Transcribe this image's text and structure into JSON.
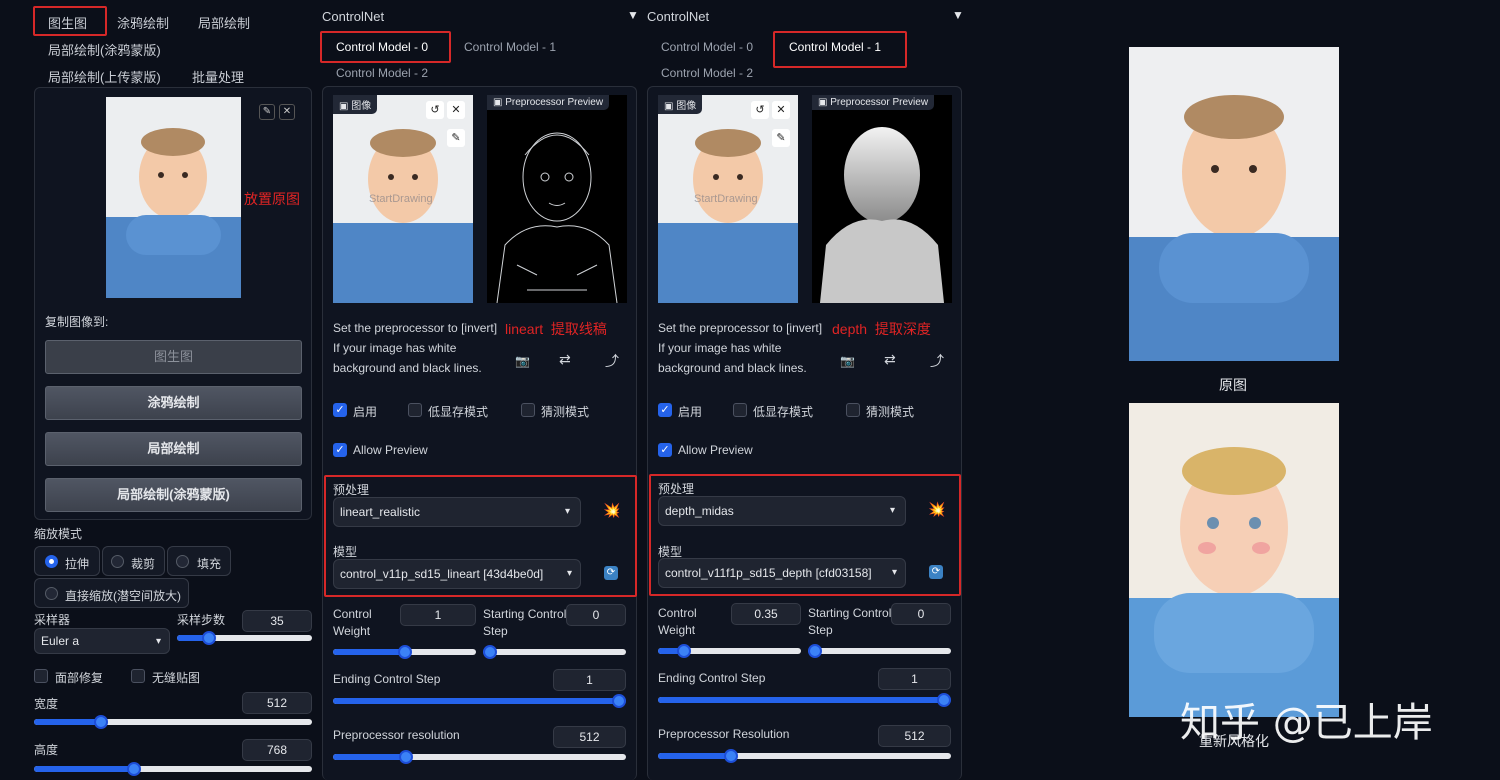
{
  "left": {
    "tabs": [
      "图生图",
      "涂鸦绘制",
      "局部绘制",
      "局部绘制(涂鸦蒙版)",
      "局部绘制(上传蒙版)",
      "批量处理"
    ],
    "annotation_place": "放置原图",
    "copy_label": "复制图像到:",
    "copy_buttons": [
      "图生图",
      "涂鸦绘制",
      "局部绘制",
      "局部绘制(涂鸦蒙版)"
    ],
    "resize_mode_label": "缩放模式",
    "resize_options": [
      "拉伸",
      "裁剪",
      "填充",
      "直接缩放(潜空间放大)"
    ],
    "sampler_label": "采样器",
    "sampler_value": "Euler a",
    "steps_label": "采样步数",
    "steps_value": "35",
    "steps_fraction": 0.24,
    "face_restore": "面部修复",
    "tiling": "无缝贴图",
    "width_label": "宽度",
    "width_value": "512",
    "width_fraction": 0.24,
    "height_label": "高度",
    "height_value": "768",
    "height_fraction": 0.36
  },
  "cn": [
    {
      "title": "ControlNet",
      "tabs": [
        "Control Model - 0",
        "Control Model - 1",
        "Control Model - 2"
      ],
      "active_tab": 0,
      "image_tag": "图像",
      "preview_tag": "Preprocessor Preview",
      "watermark": "StartDrawing",
      "hint": [
        "Set the preprocessor to [invert]",
        "If your image has white",
        "background and black lines."
      ],
      "annotation": "lineart  提取线稿",
      "enable": "启用",
      "lowvram": "低显存模式",
      "guess": "猜测模式",
      "allow_preview": "Allow Preview",
      "pre_label": "预处理",
      "pre_value": "lineart_realistic",
      "model_label": "模型",
      "model_value": "control_v11p_sd15_lineart [43d4be0d]",
      "weight_label": "Control Weight",
      "weight_value": "1",
      "weight_fraction": 0.5,
      "start_label": "Starting Control Step",
      "start_value": "0",
      "start_fraction": 0.0,
      "end_label": "Ending Control Step",
      "end_value": "1",
      "end_fraction": 1.0,
      "res_label": "Preprocessor resolution",
      "res_value": "512",
      "res_fraction": 0.25
    },
    {
      "title": "ControlNet",
      "tabs": [
        "Control Model - 0",
        "Control Model - 1",
        "Control Model - 2"
      ],
      "active_tab": 1,
      "image_tag": "图像",
      "preview_tag": "Preprocessor Preview",
      "watermark": "StartDrawing",
      "hint": [
        "Set the preprocessor to [invert]",
        "If your image has white",
        "background and black lines."
      ],
      "annotation": "depth  提取深度",
      "enable": "启用",
      "lowvram": "低显存模式",
      "guess": "猜测模式",
      "allow_preview": "Allow Preview",
      "pre_label": "预处理",
      "pre_value": "depth_midas",
      "model_label": "模型",
      "model_value": "control_v11f1p_sd15_depth [cfd03158]",
      "weight_label": "Control Weight",
      "weight_value": "0.35",
      "weight_fraction": 0.18,
      "start_label": "Starting Control Step",
      "start_value": "0",
      "start_fraction": 0.0,
      "end_label": "Ending Control Step",
      "end_value": "1",
      "end_fraction": 1.0,
      "res_label": "Preprocessor Resolution",
      "res_value": "512",
      "res_fraction": 0.25
    }
  ],
  "right": {
    "original_caption": "原图",
    "restyle_caption": "重新风格化",
    "watermark": "知乎 @已上岸"
  },
  "colors": {
    "accent": "#2563eb",
    "annotation": "#e02424",
    "bg": "#0b0f19"
  }
}
